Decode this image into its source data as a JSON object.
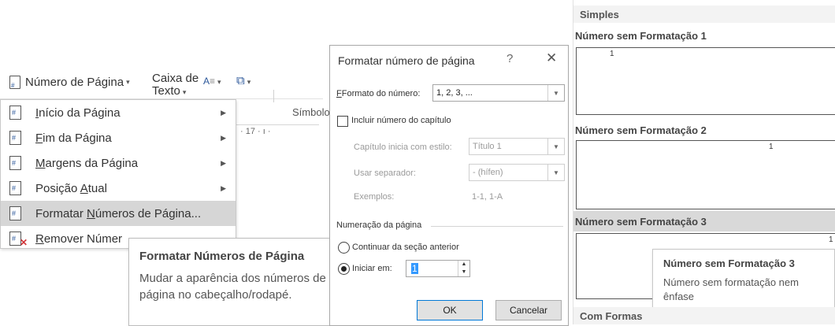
{
  "ribbon": {
    "page_number_label": "Número de Página",
    "text_box_line1": "Caixa de",
    "text_box_line2": "Texto",
    "symbols_label": "Símbolo"
  },
  "ruler": {
    "mark": "· 17 ·  ı  ·"
  },
  "page_number_menu": {
    "items": [
      {
        "label_pre": "",
        "label_accel": "I",
        "label_post": "nício da Página",
        "has_submenu": true
      },
      {
        "label_pre": "",
        "label_accel": "F",
        "label_post": "im da Página",
        "has_submenu": true
      },
      {
        "label_pre": "",
        "label_accel": "M",
        "label_post": "argens da Página",
        "has_submenu": true
      },
      {
        "label_pre": "Posição ",
        "label_accel": "A",
        "label_post": "tual",
        "has_submenu": true
      },
      {
        "label_pre": "Formatar ",
        "label_accel": "N",
        "label_post": "úmeros de Página...",
        "highlighted": true
      },
      {
        "label_pre": "",
        "label_accel": "R",
        "label_post": "emover Númer"
      }
    ]
  },
  "menu_tooltip": {
    "title": "Formatar Números de Página",
    "description": "Mudar a aparência dos números de página no cabeçalho/rodapé."
  },
  "format_dialog": {
    "title": "Formatar número de página",
    "help": "?",
    "close": "✕",
    "number_format_label": "Formato do número:",
    "number_format_value": "1, 2, 3, ...",
    "include_chapter_label": "Incluir número do capítulo",
    "chapter_style_label": "Capítulo inicia com estilo:",
    "chapter_style_value": "Título 1",
    "separator_label": "Usar separador:",
    "separator_value": "-   (hífen)",
    "examples_label": "Exemplos:",
    "examples_value": "1-1, 1-A",
    "numbering_group_label": "Numeração da página",
    "continue_label": "Continuar da seção anterior",
    "start_at_label": "Iniciar em:",
    "start_at_value": "1",
    "ok_label": "OK",
    "cancel_label": "Cancelar"
  },
  "gallery": {
    "section_header": "Simples",
    "items": [
      {
        "label": "Número sem Formatação 1",
        "number": "1"
      },
      {
        "label": "Número sem Formatação 2",
        "number": "1"
      },
      {
        "label": "Número sem Formatação 3",
        "number": "1",
        "hovered": true
      }
    ],
    "tooltip_title": "Número sem Formatação 3",
    "tooltip_description": "Número sem formatação nem ênfase",
    "next_section_header": "Com Formas"
  },
  "colors": {
    "accent": "#2b579a",
    "highlight": "#d6d6d6",
    "selection": "#3399ff",
    "remove_x": "#d13438"
  }
}
